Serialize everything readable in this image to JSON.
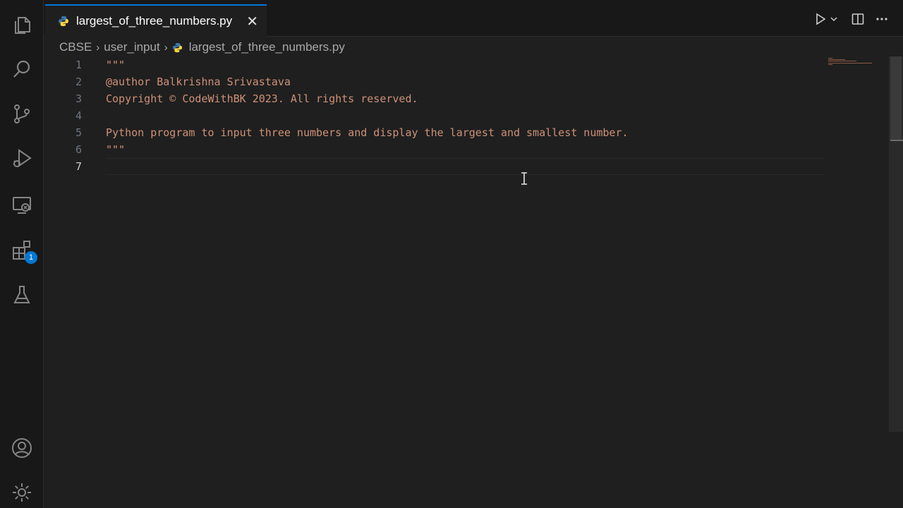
{
  "activity_bar": {
    "icons": [
      {
        "name": "explorer-icon"
      },
      {
        "name": "search-icon"
      },
      {
        "name": "source-control-icon"
      },
      {
        "name": "run-debug-icon"
      },
      {
        "name": "remote-explorer-icon"
      },
      {
        "name": "extensions-icon",
        "badge": "1"
      },
      {
        "name": "testing-icon"
      },
      {
        "name": "account-icon"
      },
      {
        "name": "manage-gear-icon"
      }
    ]
  },
  "tab": {
    "label": "largest_of_three_numbers.py",
    "close": "✕"
  },
  "breadcrumb": {
    "items": [
      "CBSE",
      "user_input",
      "largest_of_three_numbers.py"
    ],
    "separator": "›"
  },
  "editor": {
    "active_line": 7,
    "lines": [
      {
        "num": "1",
        "text": "\"\"\""
      },
      {
        "num": "2",
        "text": "@author Balkrishna Srivastava"
      },
      {
        "num": "3",
        "text": "Copyright © CodeWithBK 2023. All rights reserved."
      },
      {
        "num": "4",
        "text": ""
      },
      {
        "num": "5",
        "text": "Python program to input three numbers and display the largest and smallest number."
      },
      {
        "num": "6",
        "text": "\"\"\""
      },
      {
        "num": "7",
        "text": ""
      }
    ]
  },
  "colors": {
    "accent": "#0078d4",
    "string": "#ce9178",
    "python_blue": "#3c78aa",
    "python_yellow": "#ffd343"
  }
}
